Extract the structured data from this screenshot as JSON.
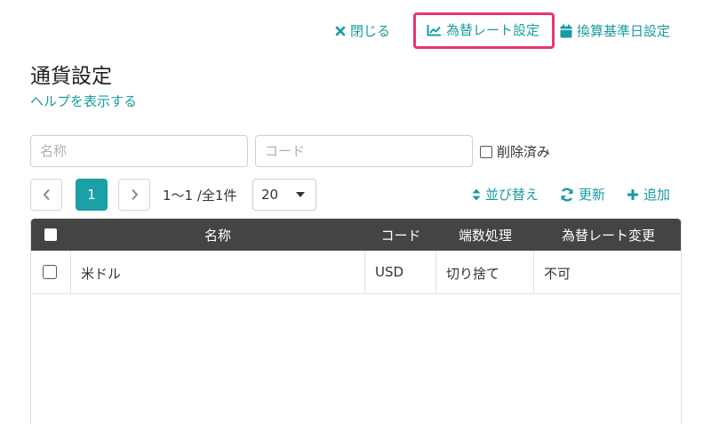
{
  "toolbar": {
    "close_label": "閉じる",
    "rate_settings_label": "為替レート設定",
    "base_date_label": "換算基準日設定"
  },
  "page": {
    "title": "通貨設定",
    "help_link": "ヘルプを表示する"
  },
  "filters": {
    "name_placeholder": "名称",
    "name_value": "",
    "code_placeholder": "コード",
    "code_value": "",
    "deleted_label": "削除済み",
    "deleted_checked": false
  },
  "pager": {
    "current_page": "1",
    "range_text": "1〜1 /全1件",
    "page_size": "20"
  },
  "actions": {
    "sort_label": "並び替え",
    "refresh_label": "更新",
    "add_label": "追加"
  },
  "table": {
    "columns": [
      "名称",
      "コード",
      "端数処理",
      "為替レート変更"
    ],
    "rows": [
      {
        "name": "米ドル",
        "code": "USD",
        "rounding": "切り捨て",
        "rate_change": "不可"
      }
    ]
  },
  "colors": {
    "accent": "#1a9ba1",
    "highlight_border": "#e8366d",
    "header_bg": "#444444",
    "pager_active": "#1aa0a6"
  }
}
